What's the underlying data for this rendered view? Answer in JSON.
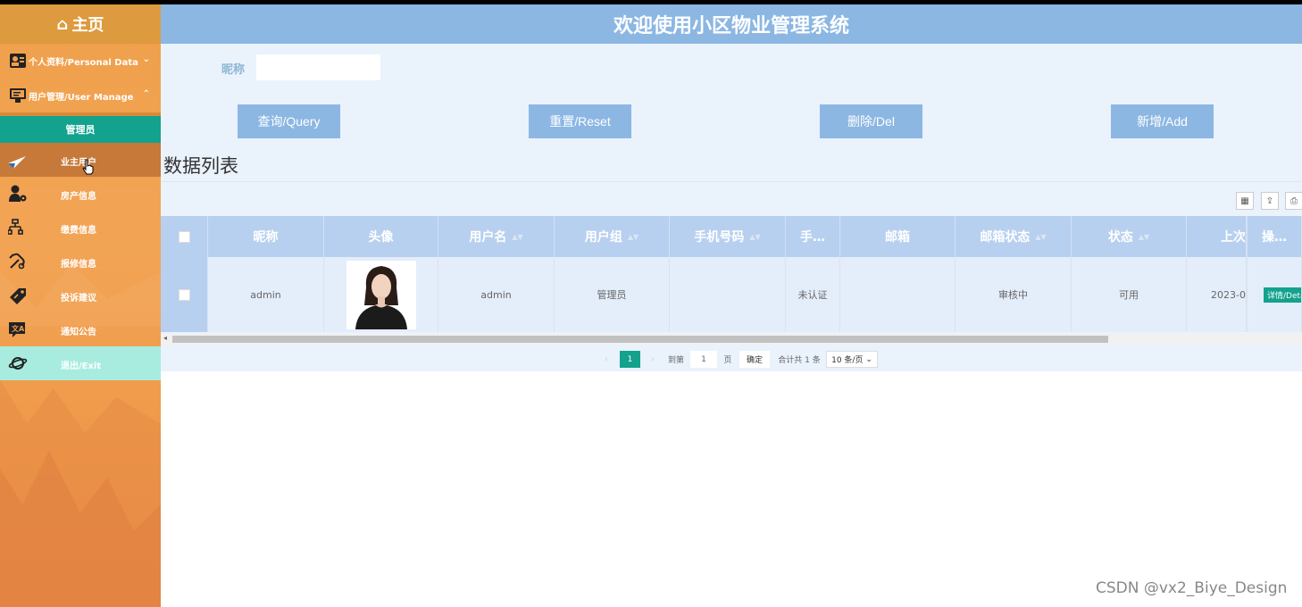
{
  "sidebar": {
    "home_label": "主页",
    "menus": [
      {
        "label": "个人资料/Personal Data",
        "icon": "id-card-icon",
        "chevron": "⌄"
      },
      {
        "label": "用户管理/User Manage",
        "icon": "monitor-icon",
        "chevron": "⌃"
      }
    ],
    "role_label": "管理员",
    "items": [
      {
        "label": "业主用户",
        "icon": "paper-plane-icon"
      },
      {
        "label": "房产信息",
        "icon": "user-gear-icon"
      },
      {
        "label": "缴费信息",
        "icon": "sitemap-icon"
      },
      {
        "label": "报修信息",
        "icon": "wrench-icon"
      },
      {
        "label": "投诉建议",
        "icon": "tag-icon"
      },
      {
        "label": "通知公告",
        "icon": "notice-icon"
      },
      {
        "label": "退出/Exit",
        "icon": "planet-icon"
      }
    ]
  },
  "header": {
    "title": "欢迎使用小区物业管理系统"
  },
  "search": {
    "label": "昵称",
    "value": "",
    "placeholder": ""
  },
  "buttons": {
    "query": "查询/Query",
    "reset": "重置/Reset",
    "delete": "删除/Del",
    "add": "新增/Add"
  },
  "list_title": "数据列表",
  "table": {
    "columns": [
      "昵称",
      "头像",
      "用户名",
      "用户组",
      "手机号码",
      "手…",
      "邮箱",
      "邮箱状态",
      "状态",
      "上次",
      "操…"
    ],
    "rows": [
      {
        "nickname": "admin",
        "username": "admin",
        "group": "管理员",
        "phone": "",
        "phone_status": "未认证",
        "email": "",
        "email_status": "审核中",
        "status": "可用",
        "last": "2023-0",
        "action": "详情/Deta"
      }
    ]
  },
  "pagination": {
    "prev": "‹",
    "current_page": "1",
    "next": "›",
    "goto_label": "到第",
    "goto_value": "1",
    "page_unit": "页",
    "confirm": "确定",
    "total": "合计共 1 条",
    "page_size": "10 条/页"
  },
  "watermark": "CSDN @vx2_Biye_Design",
  "colors": {
    "sidebar_orange": "#f0a04b",
    "teal_accent": "#13a28d",
    "header_blue": "#8cb7e3",
    "panel_bg": "#eaf2fc"
  }
}
